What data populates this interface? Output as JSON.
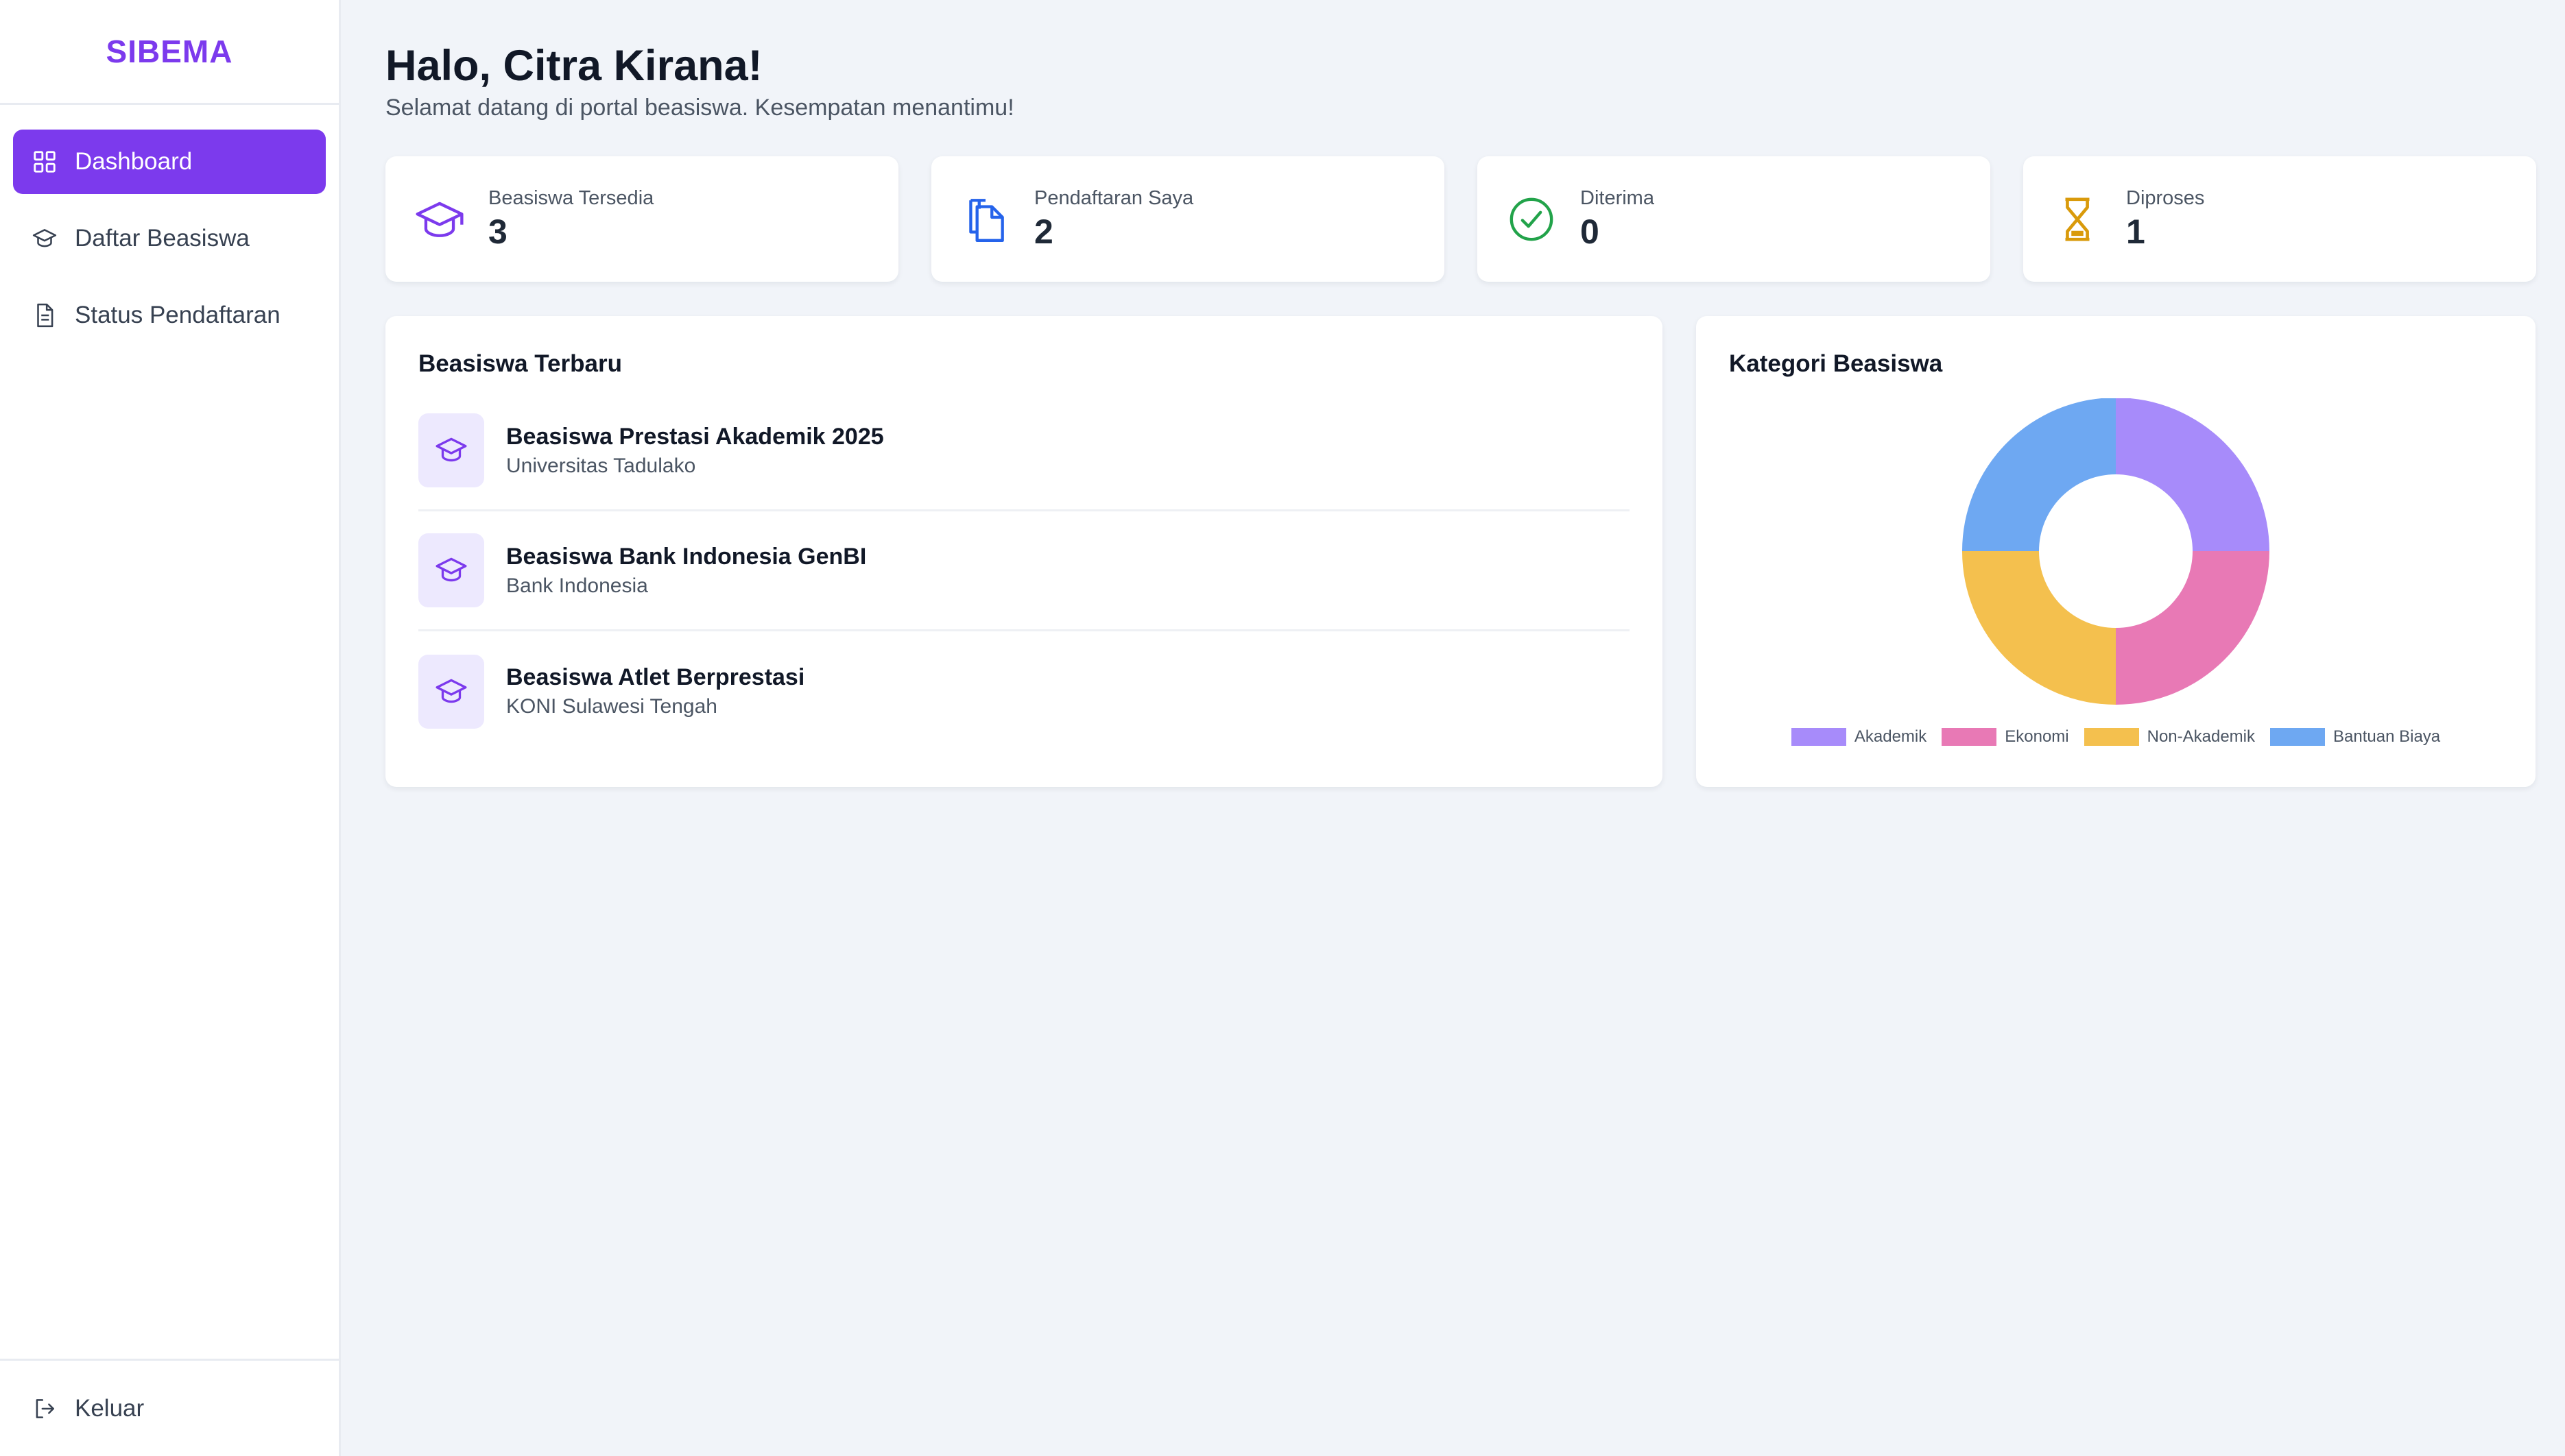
{
  "sidebar": {
    "brand": "SIBEMA",
    "items": [
      {
        "label": "Dashboard",
        "icon": "grid-icon",
        "active": true
      },
      {
        "label": "Daftar Beasiswa",
        "icon": "graduation-cap-icon",
        "active": false
      },
      {
        "label": "Status Pendaftaran",
        "icon": "document-icon",
        "active": false
      }
    ],
    "logout": {
      "label": "Keluar",
      "icon": "logout-icon"
    }
  },
  "header": {
    "greeting": "Halo, Citra Kirana!",
    "subtitle": "Selamat datang di portal beasiswa. Kesempatan menantimu!"
  },
  "stats": [
    {
      "label": "Beasiswa Tersedia",
      "value": "3",
      "icon": "graduation-cap-icon",
      "color": "#7c3aed"
    },
    {
      "label": "Pendaftaran Saya",
      "value": "2",
      "icon": "documents-icon",
      "color": "#2563eb"
    },
    {
      "label": "Diterima",
      "value": "0",
      "icon": "check-circle-icon",
      "color": "#22a34a"
    },
    {
      "label": "Diproses",
      "value": "1",
      "icon": "hourglass-icon",
      "color": "#d99a0b"
    }
  ],
  "latest": {
    "title": "Beasiswa Terbaru",
    "items": [
      {
        "title": "Beasiswa Prestasi Akademik 2025",
        "provider": "Universitas Tadulako"
      },
      {
        "title": "Beasiswa Bank Indonesia GenBI",
        "provider": "Bank Indonesia"
      },
      {
        "title": "Beasiswa Atlet Berprestasi",
        "provider": "KONI Sulawesi Tengah"
      }
    ]
  },
  "category": {
    "title": "Kategori Beasiswa"
  },
  "chart_data": {
    "type": "pie",
    "categories": [
      "Akademik",
      "Ekonomi",
      "Non-Akademik",
      "Bantuan Biaya"
    ],
    "values": [
      1,
      1,
      1,
      1
    ],
    "colors": [
      "#a78bfa",
      "#e879b5",
      "#f4c04e",
      "#6ea8f2"
    ],
    "legend": "bottom"
  }
}
